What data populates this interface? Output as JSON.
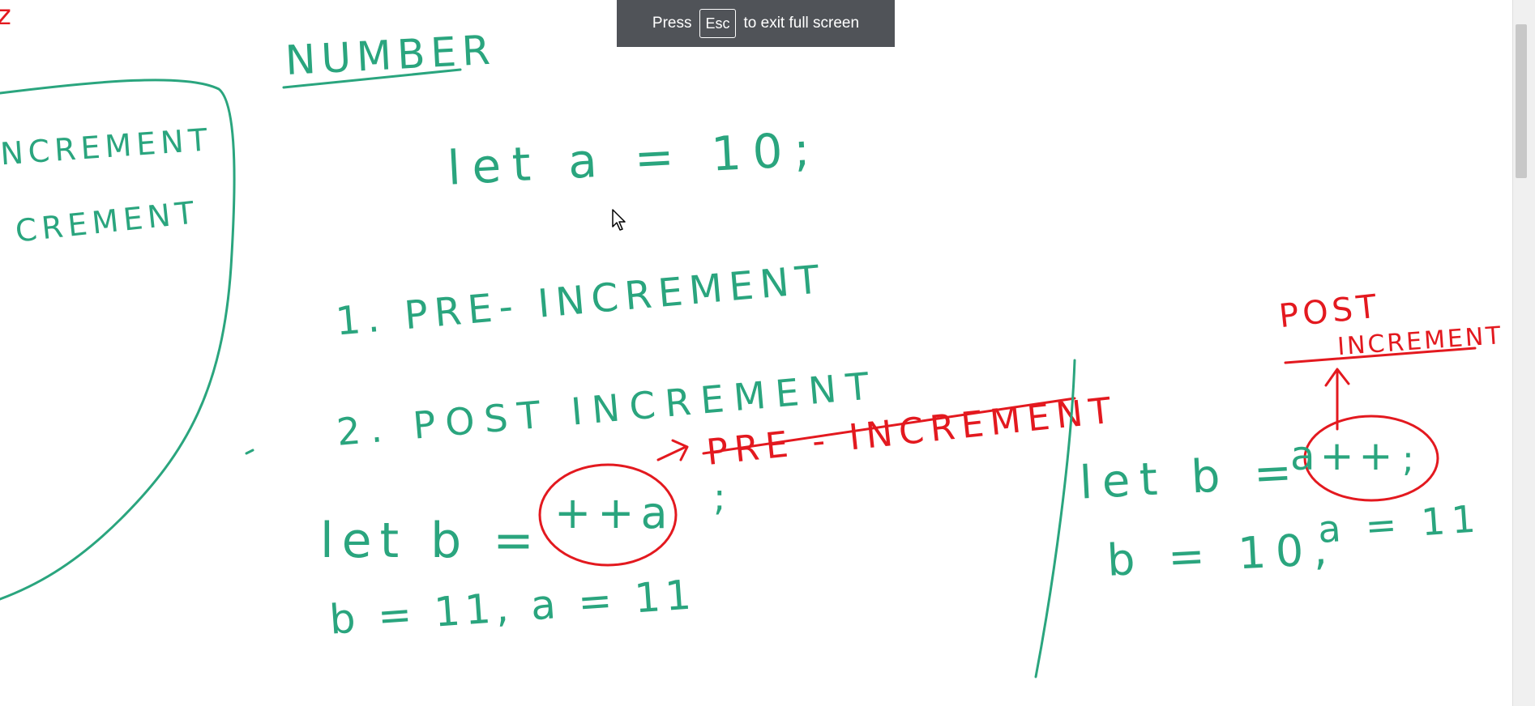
{
  "fullscreen_notice": {
    "press": "Press",
    "key": "Esc",
    "rest": "to exit full screen"
  },
  "whiteboard": {
    "title": "NUMBER",
    "declaration": "let a = 10;",
    "item_pre": "1. PRE- INCREMENT",
    "item_post": "2. POST INCREMENT",
    "left_panel_line1": "NCREMENT",
    "left_panel_line2": "CREMENT",
    "left_edge_mark": "z",
    "pre_label": "PRE - INCREMENT",
    "pre_stmt_prefix": "let b =",
    "pre_expr": "++a",
    "pre_semicolon": ";",
    "pre_result": "b = 11,   a = 11",
    "post_label_line1": "POST",
    "post_label_line2": "INCREMENT",
    "post_stmt_prefix": "let b =",
    "post_expr": "a++",
    "post_semicolon": ";",
    "post_result_b": "b = 10,",
    "post_result_a": "a = 11"
  },
  "colors": {
    "ink_green": "#2aa57e",
    "ink_red": "#e3191f",
    "banner_bg": "#505358"
  }
}
